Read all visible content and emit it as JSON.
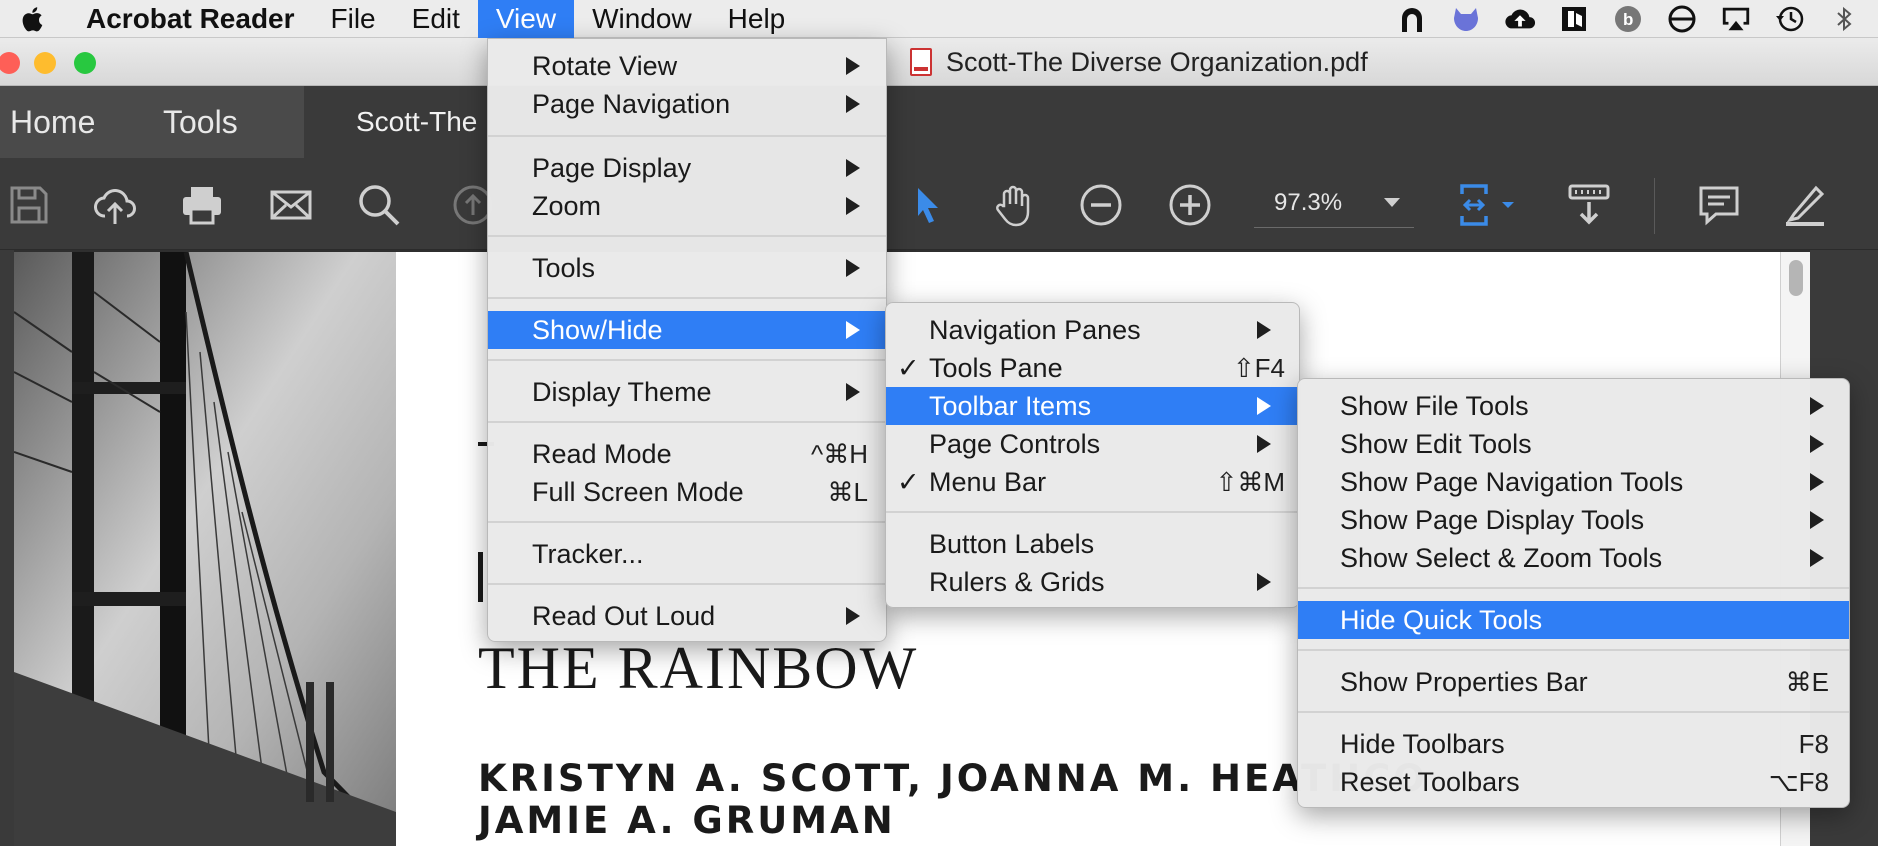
{
  "menubar": {
    "app_name": "Acrobat Reader",
    "items": [
      "File",
      "Edit",
      "View",
      "Window",
      "Help"
    ],
    "active_item": "View",
    "status_icons": [
      "tunnel-icon",
      "cat-icon",
      "cloud-upload-icon",
      "reader-icon",
      "b-circle-icon",
      "no-entry-circle-icon",
      "airplay-icon",
      "time-machine-icon",
      "bluetooth-icon"
    ]
  },
  "window": {
    "title": "Scott-The Diverse Organization.pdf",
    "traffic_lights": {
      "close": "#fe5f57",
      "minimize": "#febc2e",
      "zoom": "#28c840"
    }
  },
  "tabs": {
    "home": "Home",
    "tools": "Tools",
    "document": "Scott-The"
  },
  "toolbar": {
    "zoom_value": "97.3%",
    "buttons": [
      "save-icon",
      "cloud-upload-icon",
      "print-icon",
      "mail-icon",
      "search-icon",
      "page-up-icon",
      "select-arrow-icon",
      "hand-icon",
      "zoom-out-icon",
      "zoom-in-icon",
      "fit-page-icon",
      "scroll-mode-icon",
      "comment-icon",
      "highlight-pen-icon"
    ],
    "accent_color": "#3b8be8"
  },
  "document": {
    "heading_line": "THE RAINBOW",
    "authors_line1": "KRISTYN A. SCOTT, JOANNA M. HEATHCO",
    "authors_line2": "JAMIE A. GRUMAN"
  },
  "view_menu": {
    "items": [
      {
        "label": "Rotate View",
        "submenu": true
      },
      {
        "label": "Page Navigation",
        "submenu": true
      },
      {
        "label": "Page Display",
        "submenu": true
      },
      {
        "label": "Zoom",
        "submenu": true
      },
      {
        "label": "Tools",
        "submenu": true
      },
      {
        "label": "Show/Hide",
        "submenu": true,
        "highlighted": true
      },
      {
        "label": "Display Theme",
        "submenu": true
      },
      {
        "label": "Read Mode",
        "shortcut": "^⌘H"
      },
      {
        "label": "Full Screen Mode",
        "shortcut": "⌘L"
      },
      {
        "label": "Tracker..."
      },
      {
        "label": "Read Out Loud",
        "submenu": true
      }
    ]
  },
  "showhide_menu": {
    "items": [
      {
        "label": "Navigation Panes",
        "submenu": true
      },
      {
        "label": "Tools Pane",
        "checked": true,
        "shortcut": "⇧F4"
      },
      {
        "label": "Toolbar Items",
        "submenu": true,
        "highlighted": true
      },
      {
        "label": "Page Controls",
        "submenu": true
      },
      {
        "label": "Menu Bar",
        "checked": true,
        "shortcut": "⇧⌘M"
      },
      {
        "label": "Button Labels"
      },
      {
        "label": "Rulers & Grids",
        "submenu": true
      }
    ],
    "check_mark": "✓"
  },
  "toolbar_items_menu": {
    "items": [
      {
        "label": "Show File Tools",
        "submenu": true
      },
      {
        "label": "Show Edit Tools",
        "submenu": true
      },
      {
        "label": "Show Page Navigation Tools",
        "submenu": true
      },
      {
        "label": "Show Page Display Tools",
        "submenu": true
      },
      {
        "label": "Show Select & Zoom Tools",
        "submenu": true
      },
      {
        "label": "Hide Quick Tools",
        "highlighted": true
      },
      {
        "label": "Show Properties Bar",
        "shortcut": "⌘E"
      },
      {
        "label": "Hide Toolbars",
        "shortcut": "F8"
      },
      {
        "label": "Reset Toolbars",
        "shortcut": "⌥F8"
      }
    ]
  },
  "colors": {
    "menu_highlight": "#2f7ef5",
    "menubar_bg": "#ececec",
    "toolbar_bg": "#3a3a3a"
  }
}
